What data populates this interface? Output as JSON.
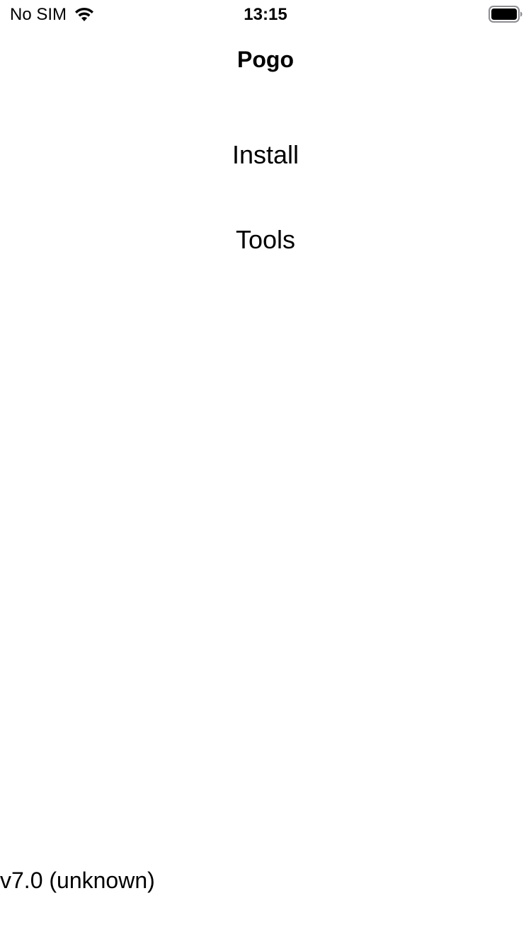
{
  "status_bar": {
    "carrier": "No SIM",
    "time": "13:15",
    "wifi_icon": "wifi-icon",
    "battery_icon": "battery-icon"
  },
  "nav": {
    "title": "Pogo"
  },
  "menu": {
    "install_label": "Install",
    "tools_label": "Tools"
  },
  "footer": {
    "version": "v7.0 (unknown)"
  },
  "colors": {
    "background": "#ffffff",
    "text": "#000000"
  }
}
